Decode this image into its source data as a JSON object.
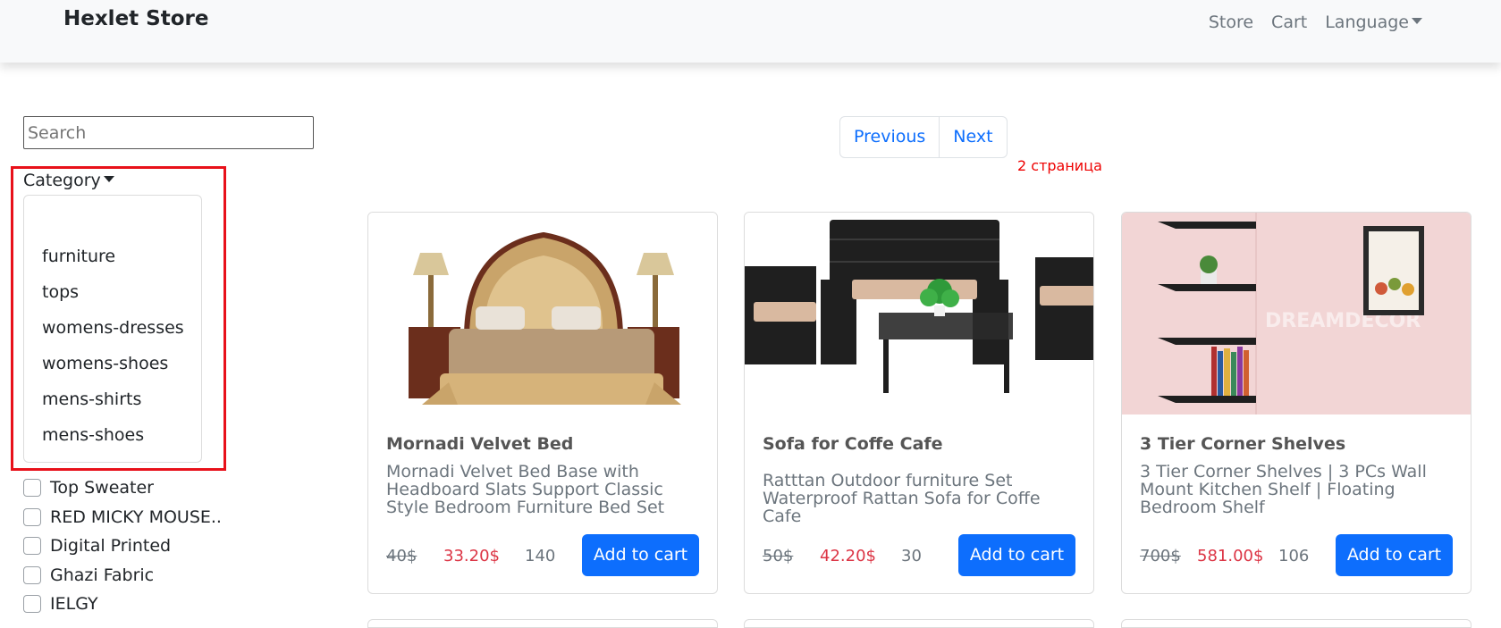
{
  "navbar": {
    "brand": "Hexlet Store",
    "links": [
      "Store",
      "Cart",
      "Language"
    ]
  },
  "sidebar": {
    "search_placeholder": "Search",
    "category_label": "Category",
    "category_options": [
      "furniture",
      "tops",
      "womens-dresses",
      "womens-shoes",
      "mens-shirts",
      "mens-shoes"
    ],
    "filters": [
      "Top Sweater",
      "RED MICKY MOUSE..",
      "Digital Printed",
      "Ghazi Fabric",
      "IELGY"
    ]
  },
  "pagination": {
    "previous": "Previous",
    "next": "Next",
    "page_label": "2 страница"
  },
  "products": [
    {
      "title": "Mornadi Velvet Bed",
      "description": "Mornadi Velvet Bed Base with Headboard Slats Support Classic Style Bedroom Furniture Bed Set",
      "old_price": "40$",
      "price": "33.20$",
      "stock": "140",
      "button": "Add to cart"
    },
    {
      "title": "Sofa for Coffe Cafe",
      "description": "Ratttan Outdoor furniture Set Waterproof Rattan Sofa for Coffe Cafe",
      "old_price": "50$",
      "price": "42.20$",
      "stock": "30",
      "button": "Add to cart"
    },
    {
      "title": "3 Tier Corner Shelves",
      "description": "3 Tier Corner Shelves | 3 PCs Wall Mount Kitchen Shelf | Floating Bedroom Shelf",
      "old_price": "700$",
      "price": "581.00$",
      "stock": "106",
      "button": "Add to cart"
    }
  ],
  "colors": {
    "accent": "#0d6efd",
    "sale_price": "#dc3545",
    "highlight": "#e8111a"
  }
}
